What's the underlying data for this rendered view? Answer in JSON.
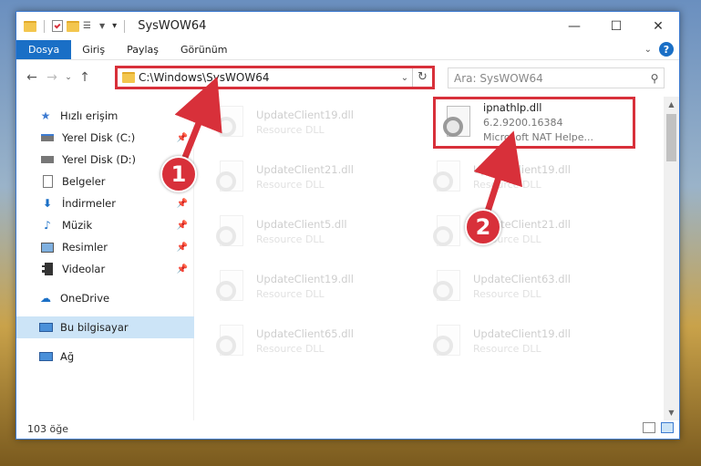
{
  "window": {
    "title": "SysWOW64",
    "controls": {
      "minimize": "—",
      "maximize": "☐",
      "close": "✕"
    }
  },
  "ribbon": {
    "tabs": [
      "Dosya",
      "Giriş",
      "Paylaş",
      "Görünüm"
    ],
    "help_label": "?"
  },
  "nav": {
    "address": "C:\\Windows\\SysWOW64",
    "search_placeholder": "Ara: SysWOW64"
  },
  "sidebar": {
    "quick_access": "Hızlı erişim",
    "items": [
      {
        "label": "Yerel Disk (C:)",
        "icon": "drive-icon",
        "pinned": true
      },
      {
        "label": "Yerel Disk (D:)",
        "icon": "drive-icon",
        "pinned": false
      },
      {
        "label": "Belgeler",
        "icon": "documents-icon",
        "pinned": true
      },
      {
        "label": "İndirmeler",
        "icon": "downloads-icon",
        "pinned": true
      },
      {
        "label": "Müzik",
        "icon": "music-icon",
        "pinned": true
      },
      {
        "label": "Resimler",
        "icon": "pictures-icon",
        "pinned": true
      },
      {
        "label": "Videolar",
        "icon": "videos-icon",
        "pinned": true
      }
    ],
    "onedrive": "OneDrive",
    "this_pc": "Bu bilgisayar",
    "network": "Ağ"
  },
  "files": [
    {
      "name": "UpdateClient19.dll",
      "desc": "Resource DLL",
      "highlighted": false
    },
    {
      "name": "ipnathlp.dll",
      "desc": "6.2.9200.16384",
      "desc2": "Microsoft NAT Helpe...",
      "highlighted": true
    },
    {
      "name": "UpdateClient21.dll",
      "desc": "Resource DLL",
      "highlighted": false
    },
    {
      "name": "UpdateClient19.dll",
      "desc": "Resource DLL",
      "highlighted": false
    },
    {
      "name": "UpdateClient5.dll",
      "desc": "Resource DLL",
      "highlighted": false
    },
    {
      "name": "UpdateClient21.dll",
      "desc": "Resource DLL",
      "highlighted": false
    },
    {
      "name": "UpdateClient19.dll",
      "desc": "Resource DLL",
      "highlighted": false
    },
    {
      "name": "UpdateClient63.dll",
      "desc": "Resource DLL",
      "highlighted": false
    },
    {
      "name": "UpdateClient65.dll",
      "desc": "Resource DLL",
      "highlighted": false
    },
    {
      "name": "UpdateClient19.dll",
      "desc": "Resource DLL",
      "highlighted": false
    }
  ],
  "status": {
    "count": "103 öğe"
  },
  "annotations": {
    "badge1": "1",
    "badge2": "2",
    "color": "#d8303a"
  }
}
